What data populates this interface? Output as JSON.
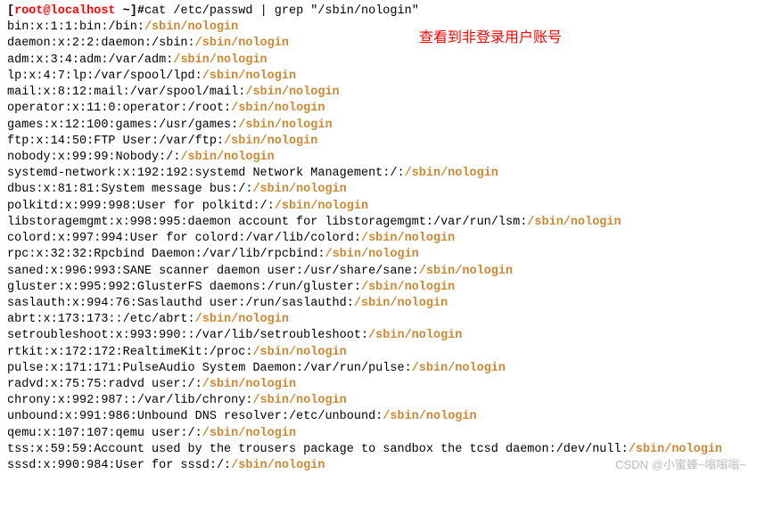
{
  "prompt": {
    "user_host": "root@localhost",
    "cwd": "~",
    "symbol": "#",
    "command": "cat /etc/passwd | grep \"/sbin/nologin\""
  },
  "annotation": "查看到非登录用户账号",
  "watermark": "CSDN @小蜜蜂~嗡嗡嗡~",
  "lines": [
    {
      "prefix": "bin:x:1:1:bin:/bin:",
      "hl": "/sbin/nologin"
    },
    {
      "prefix": "daemon:x:2:2:daemon:/sbin:",
      "hl": "/sbin/nologin"
    },
    {
      "prefix": "adm:x:3:4:adm:/var/adm:",
      "hl": "/sbin/nologin"
    },
    {
      "prefix": "lp:x:4:7:lp:/var/spool/lpd:",
      "hl": "/sbin/nologin"
    },
    {
      "prefix": "mail:x:8:12:mail:/var/spool/mail:",
      "hl": "/sbin/nologin"
    },
    {
      "prefix": "operator:x:11:0:operator:/root:",
      "hl": "/sbin/nologin"
    },
    {
      "prefix": "games:x:12:100:games:/usr/games:",
      "hl": "/sbin/nologin"
    },
    {
      "prefix": "ftp:x:14:50:FTP User:/var/ftp:",
      "hl": "/sbin/nologin"
    },
    {
      "prefix": "nobody:x:99:99:Nobody:/:",
      "hl": "/sbin/nologin"
    },
    {
      "prefix": "systemd-network:x:192:192:systemd Network Management:/:",
      "hl": "/sbin/nologin"
    },
    {
      "prefix": "dbus:x:81:81:System message bus:/:",
      "hl": "/sbin/nologin"
    },
    {
      "prefix": "polkitd:x:999:998:User for polkitd:/:",
      "hl": "/sbin/nologin"
    },
    {
      "prefix": "libstoragemgmt:x:998:995:daemon account for libstoragemgmt:/var/run/lsm:",
      "hl": "/sbin/nologin"
    },
    {
      "prefix": "colord:x:997:994:User for colord:/var/lib/colord:",
      "hl": "/sbin/nologin"
    },
    {
      "prefix": "rpc:x:32:32:Rpcbind Daemon:/var/lib/rpcbind:",
      "hl": "/sbin/nologin"
    },
    {
      "prefix": "saned:x:996:993:SANE scanner daemon user:/usr/share/sane:",
      "hl": "/sbin/nologin"
    },
    {
      "prefix": "gluster:x:995:992:GlusterFS daemons:/run/gluster:",
      "hl": "/sbin/nologin"
    },
    {
      "prefix": "saslauth:x:994:76:Saslauthd user:/run/saslauthd:",
      "hl": "/sbin/nologin"
    },
    {
      "prefix": "abrt:x:173:173::/etc/abrt:",
      "hl": "/sbin/nologin"
    },
    {
      "prefix": "setroubleshoot:x:993:990::/var/lib/setroubleshoot:",
      "hl": "/sbin/nologin"
    },
    {
      "prefix": "rtkit:x:172:172:RealtimeKit:/proc:",
      "hl": "/sbin/nologin"
    },
    {
      "prefix": "pulse:x:171:171:PulseAudio System Daemon:/var/run/pulse:",
      "hl": "/sbin/nologin"
    },
    {
      "prefix": "radvd:x:75:75:radvd user:/:",
      "hl": "/sbin/nologin"
    },
    {
      "prefix": "chrony:x:992:987::/var/lib/chrony:",
      "hl": "/sbin/nologin"
    },
    {
      "prefix": "unbound:x:991:986:Unbound DNS resolver:/etc/unbound:",
      "hl": "/sbin/nologin"
    },
    {
      "prefix": "qemu:x:107:107:qemu user:/:",
      "hl": "/sbin/nologin"
    },
    {
      "prefix": "tss:x:59:59:Account used by the trousers package to sandbox the tcsd daemon:/dev/null:",
      "hl": "/sbin/nologin",
      "wrap": true,
      "wrap_prefix_len": 101
    },
    {
      "prefix": "sssd:x:990:984:User for sssd:/:",
      "hl": "/sbin/nologin"
    }
  ]
}
